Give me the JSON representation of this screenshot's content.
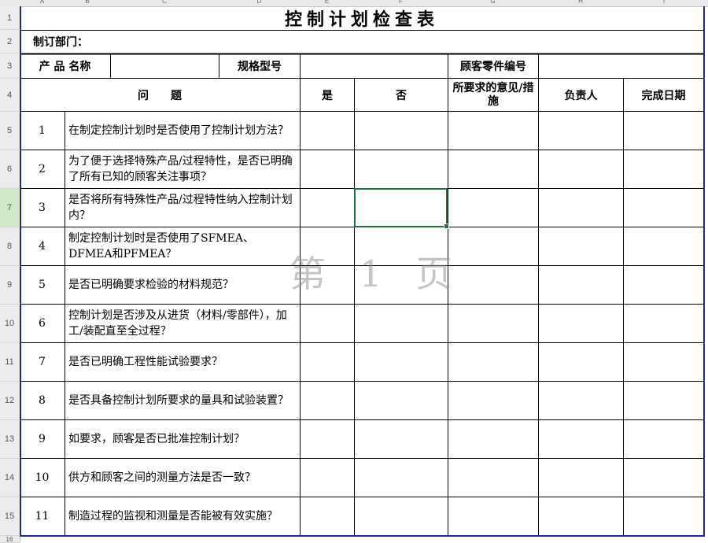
{
  "column_headers": [
    "A",
    "B",
    "C",
    "D",
    "E",
    "F",
    "G",
    "H",
    "I"
  ],
  "row_headers": [
    "1",
    "2",
    "3",
    "4",
    "5",
    "6",
    "7",
    "8",
    "9",
    "10",
    "11",
    "12",
    "13",
    "14",
    "15",
    "16"
  ],
  "title": "控制计划检查表",
  "dept_label": "制订部门：",
  "product_name_label": "产 品 名称",
  "spec_model_label": "规格型号",
  "customer_part_label": "顾客零件编号",
  "headers": {
    "question": "问　　题",
    "yes": "是",
    "no": "否",
    "required_opinion": "所要求的意见/措施",
    "owner": "负责人",
    "completion_date": "完成日期"
  },
  "rows": [
    {
      "no": "1",
      "question": "在制定控制计划时是否使用了控制计划方法？"
    },
    {
      "no": "2",
      "question": "为了便于选择特殊产品/过程特性，是否已明确了所有已知的顾客关注事项？"
    },
    {
      "no": "3",
      "question": "是否将所有特殊性产品/过程特性纳入控制计划内？"
    },
    {
      "no": "4",
      "question": "制定控制计划时是否使用了SFMEA、DFMEA和PFMEA？"
    },
    {
      "no": "5",
      "question": "是否已明确要求检验的材料规范？"
    },
    {
      "no": "6",
      "question": "控制计划是否涉及从进货（材料/零部件），加工/装配直至全过程？"
    },
    {
      "no": "7",
      "question": "是否已明确工程性能试验要求？"
    },
    {
      "no": "8",
      "question": "是否具备控制计划所要求的量具和试验装置？"
    },
    {
      "no": "9",
      "question": "如要求，顾客是否已批准控制计划？"
    },
    {
      "no": "10",
      "question": "供方和顾客之间的测量方法是否一致？"
    },
    {
      "no": "11",
      "question": "制造过程的监视和测量是否能被有效实施？"
    }
  ],
  "watermark": "第 1 页",
  "colors": {
    "sheet_border": "#1f2a8a",
    "selection": "#217346"
  }
}
